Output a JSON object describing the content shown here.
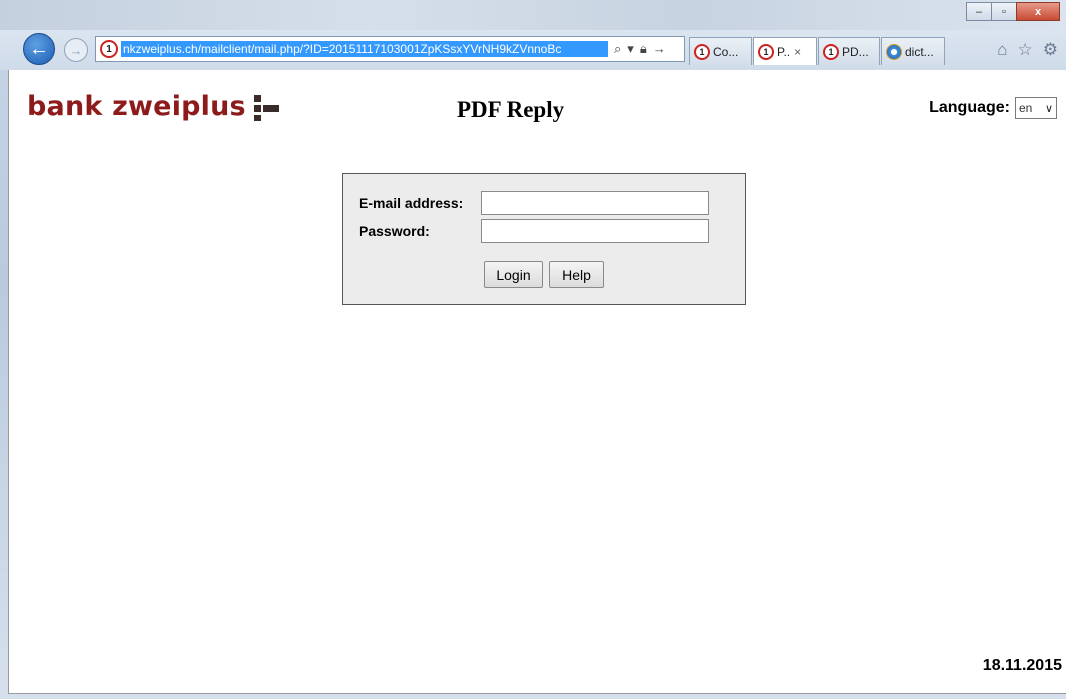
{
  "browser": {
    "url": "nkzweiplus.ch/mailclient/mail.php/?ID=20151117103001ZpKSsxYVrNH9kZVnnoBc",
    "site_icon_glyph": "1",
    "tabs": [
      {
        "label": "Co...",
        "icon": "site-icon",
        "active": false
      },
      {
        "label": "P..",
        "icon": "site-icon",
        "active": true,
        "close": "×"
      },
      {
        "label": "PD...",
        "icon": "site-icon",
        "active": false
      },
      {
        "label": "dict...",
        "icon": "ie-icon",
        "active": false
      }
    ],
    "window_buttons": {
      "minimize": "‒",
      "maximize": "▫",
      "close": "x"
    }
  },
  "logo": {
    "text": "bank zweiplus",
    "color": "#8d1b1b"
  },
  "page": {
    "title": "PDF Reply"
  },
  "language": {
    "label": "Language:",
    "selected": "en"
  },
  "form": {
    "email_label": "E-mail address:",
    "email_value": "",
    "password_label": "Password:",
    "password_value": "",
    "login_button": "Login",
    "help_button": "Help"
  },
  "footer": {
    "date": "18.11.2015"
  },
  "colors": {
    "brand": "#8d1b1b",
    "selection": "#3399ff",
    "form_bg": "#ececec"
  }
}
